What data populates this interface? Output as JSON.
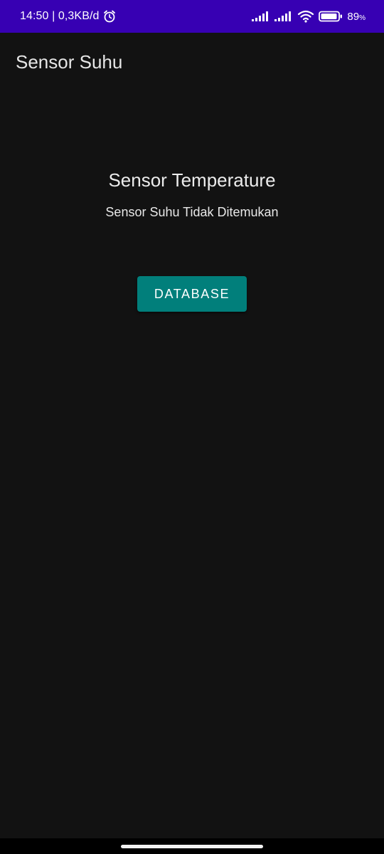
{
  "status_bar": {
    "time_and_speed": "14:50 | 0,3KB/d",
    "battery": "89",
    "battery_unit": "%",
    "color": "#3700B3",
    "icons": [
      "alarm-icon",
      "signal-icon",
      "signal-icon",
      "wifi-icon",
      "battery-icon"
    ]
  },
  "toolbar": {
    "title": "Sensor Suhu"
  },
  "main": {
    "title": "Sensor Temperature",
    "status_text": "Sensor Suhu Tidak Ditemukan",
    "database_button_label": "DATABASE",
    "button_color": "#017F7B"
  },
  "theme": {
    "background": "#121212"
  }
}
